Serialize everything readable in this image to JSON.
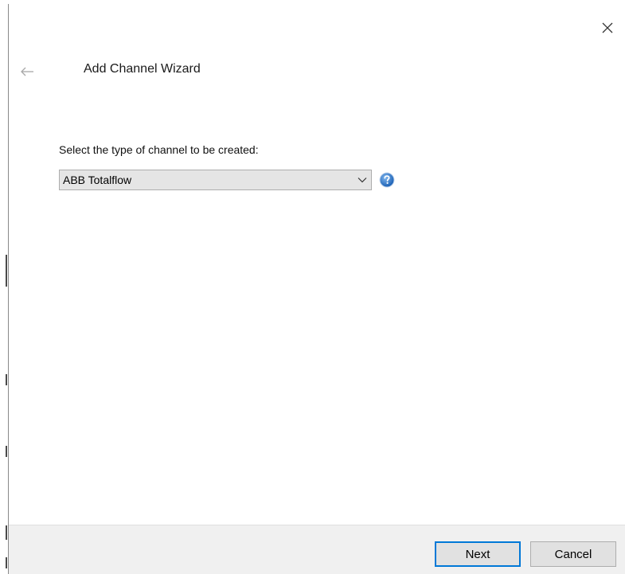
{
  "window": {
    "title": "Add Channel Wizard"
  },
  "icons": {
    "close": "close-icon",
    "back": "back-arrow-icon",
    "chevron": "chevron-down-icon",
    "help": "help-icon"
  },
  "main": {
    "type_label": "Select the type of channel to be created:",
    "channel_type": {
      "selected": "ABB Totalflow"
    }
  },
  "footer": {
    "next_label": "Next",
    "cancel_label": "Cancel"
  },
  "colors": {
    "accent": "#0078d7",
    "help_icon": "#1a73c9",
    "footer_bg": "#f0f0f0",
    "select_bg": "#e5e5e5"
  }
}
